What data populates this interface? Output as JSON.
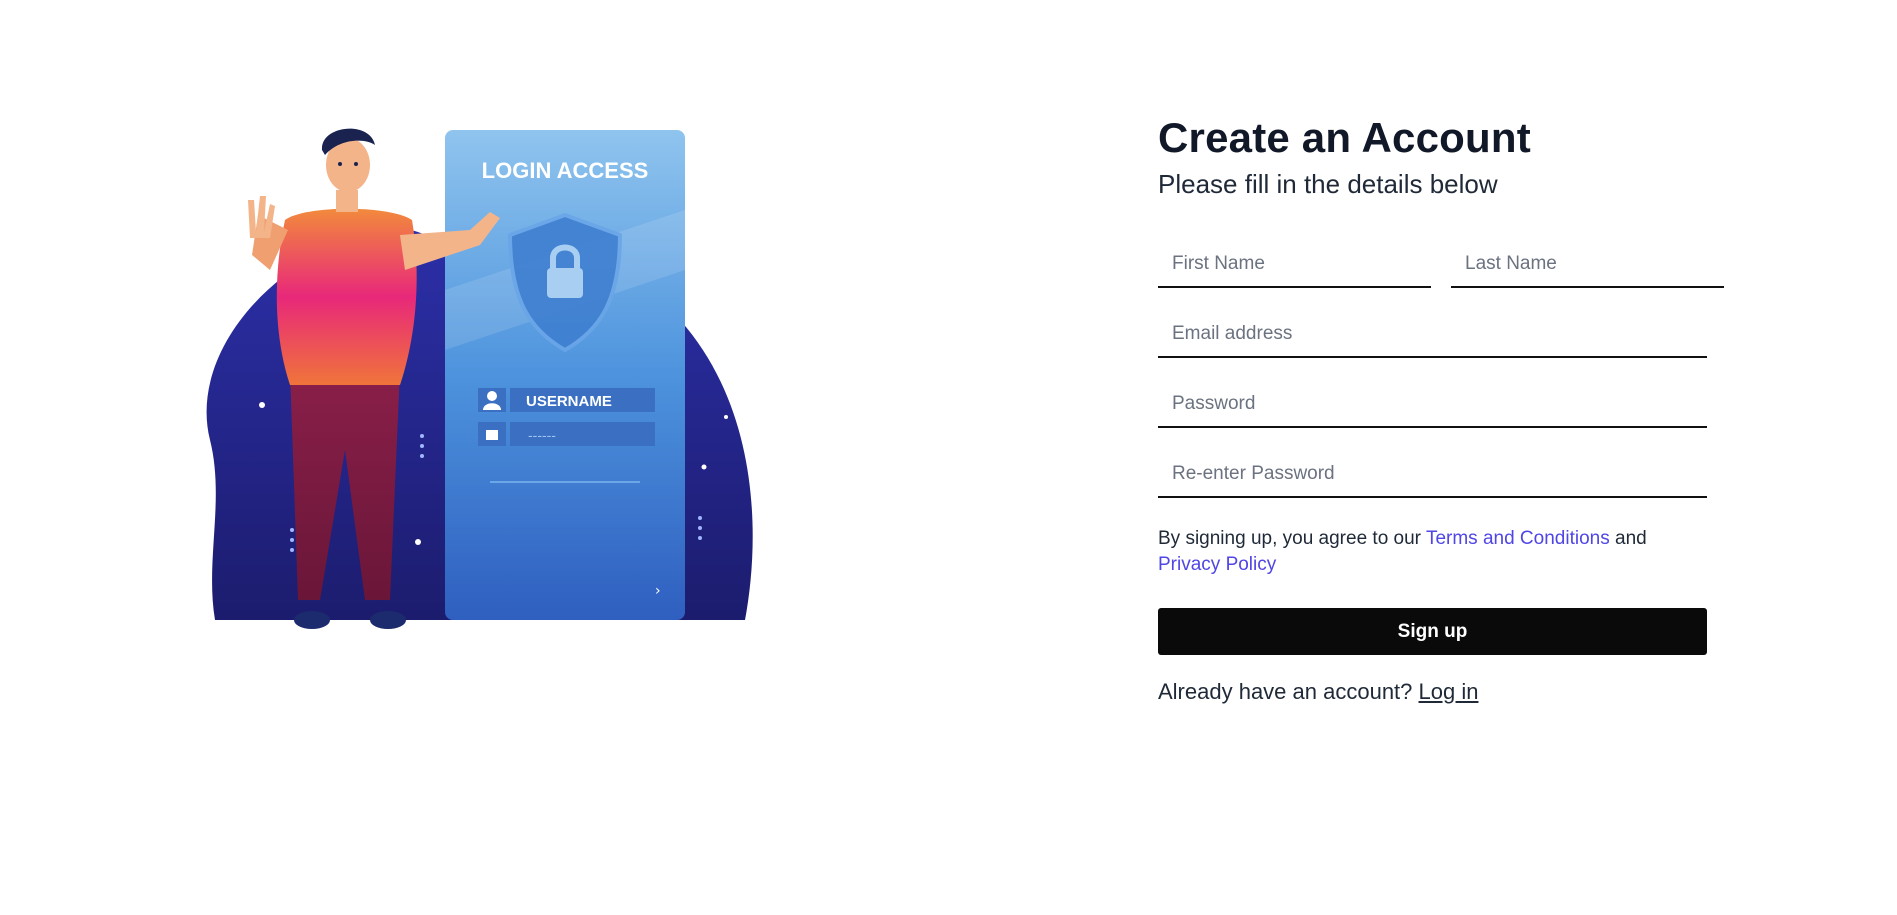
{
  "illustration": {
    "card_title": "LOGIN ACCESS",
    "username_label": "USERNAME",
    "password_mask": "------",
    "icon": "person-with-login-card-illustration"
  },
  "form": {
    "title": "Create an Account",
    "subtitle": "Please fill in the details below",
    "first_name_placeholder": "First Name",
    "last_name_placeholder": "Last Name",
    "email_placeholder": "Email address",
    "password_placeholder": "Password",
    "reenter_placeholder": "Re-enter Password",
    "terms_prefix": "By signing up, you agree to our ",
    "terms_link": "Terms and Conditions",
    "terms_mid": " and",
    "privacy_link": "Privacy Policy",
    "signup_label": "Sign up",
    "login_prompt": "Already have an account? ",
    "login_link": "Log in"
  },
  "colors": {
    "accent_link": "#4f46e5",
    "button_bg": "#0a0a0a",
    "illustration_blob": "#2a2a9e",
    "card_blue": "#4a90e2"
  }
}
